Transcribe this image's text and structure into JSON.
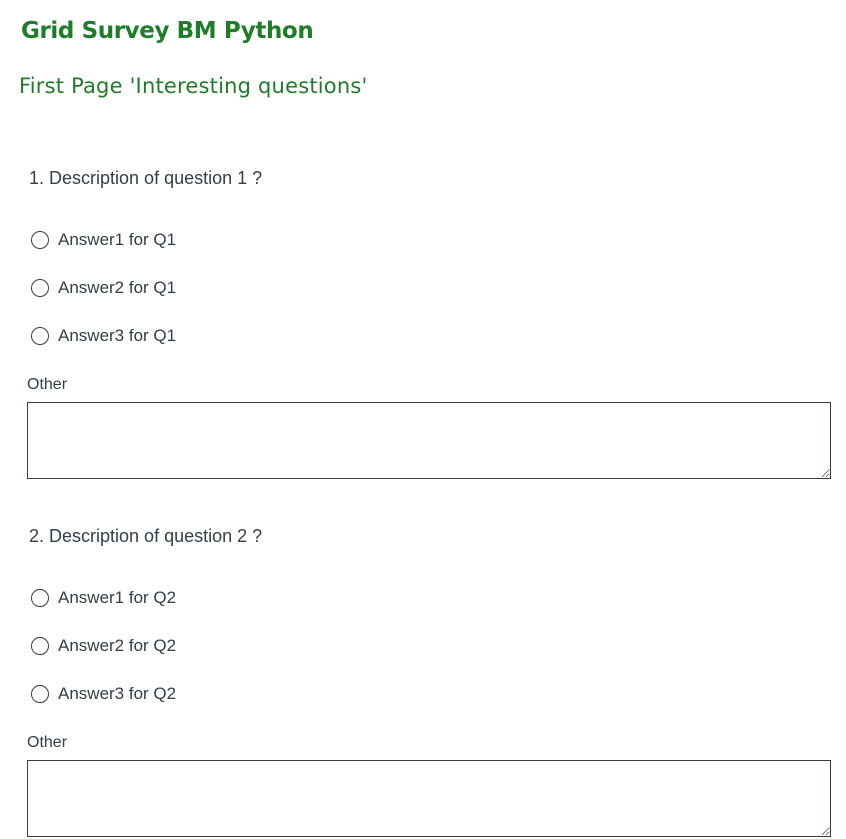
{
  "survey": {
    "title": "Grid Survey BM Python",
    "page_title": "First Page 'Interesting questions'"
  },
  "questions": [
    {
      "number": "1.",
      "text": "Description of question 1 ?",
      "answers": [
        "Answer1 for Q1",
        "Answer2 for Q1",
        "Answer3 for Q1"
      ],
      "other_label": "Other",
      "other_value": ""
    },
    {
      "number": "2.",
      "text": "Description of question 2 ?",
      "answers": [
        "Answer1 for Q2",
        "Answer2 for Q2",
        "Answer3 for Q2"
      ],
      "other_label": "Other",
      "other_value": ""
    }
  ],
  "colors": {
    "title_green": "#1e7d28",
    "text": "#333e48",
    "border": "#333e48",
    "background": "#ffffff"
  },
  "icons": {
    "answer_option": "radio-unchecked-icon"
  }
}
